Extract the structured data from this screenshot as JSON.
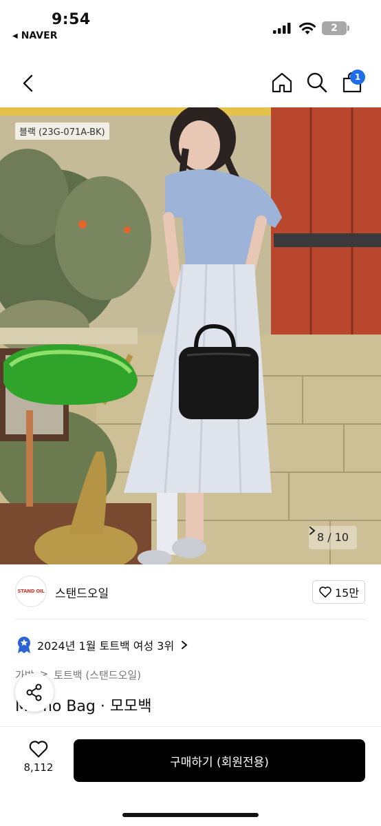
{
  "status_bar": {
    "time": "9:54",
    "back_app": "NAVER",
    "battery_level": "2"
  },
  "header": {
    "cart_count": "1",
    "icons": [
      "chevron-left-icon",
      "home-icon",
      "search-icon",
      "shopping-bag-icon"
    ]
  },
  "gallery": {
    "option_label": "블랙 (23G-071A-BK)",
    "page_indicator": "8 / 10",
    "current_page": 8,
    "total_pages": 10
  },
  "seller": {
    "logo_text": "STAND OIL",
    "name": "스탠드오일",
    "favorites": "15만"
  },
  "ranking": {
    "text": "2024년 1월 토트백 여성 3위",
    "badge_color": "#2a63d6"
  },
  "breadcrumb": {
    "items": [
      "가방",
      "토트백 (스탠드오일)"
    ],
    "separator": ">"
  },
  "product": {
    "title": "Momo Bag · 모모백"
  },
  "bottom_bar": {
    "like_count": "8,112",
    "buy_label": "구매하기 (회원전용)"
  },
  "colors": {
    "accent_blue": "#1f6de8",
    "buy_button": "#000000",
    "brand_red": "#d23b2f"
  }
}
